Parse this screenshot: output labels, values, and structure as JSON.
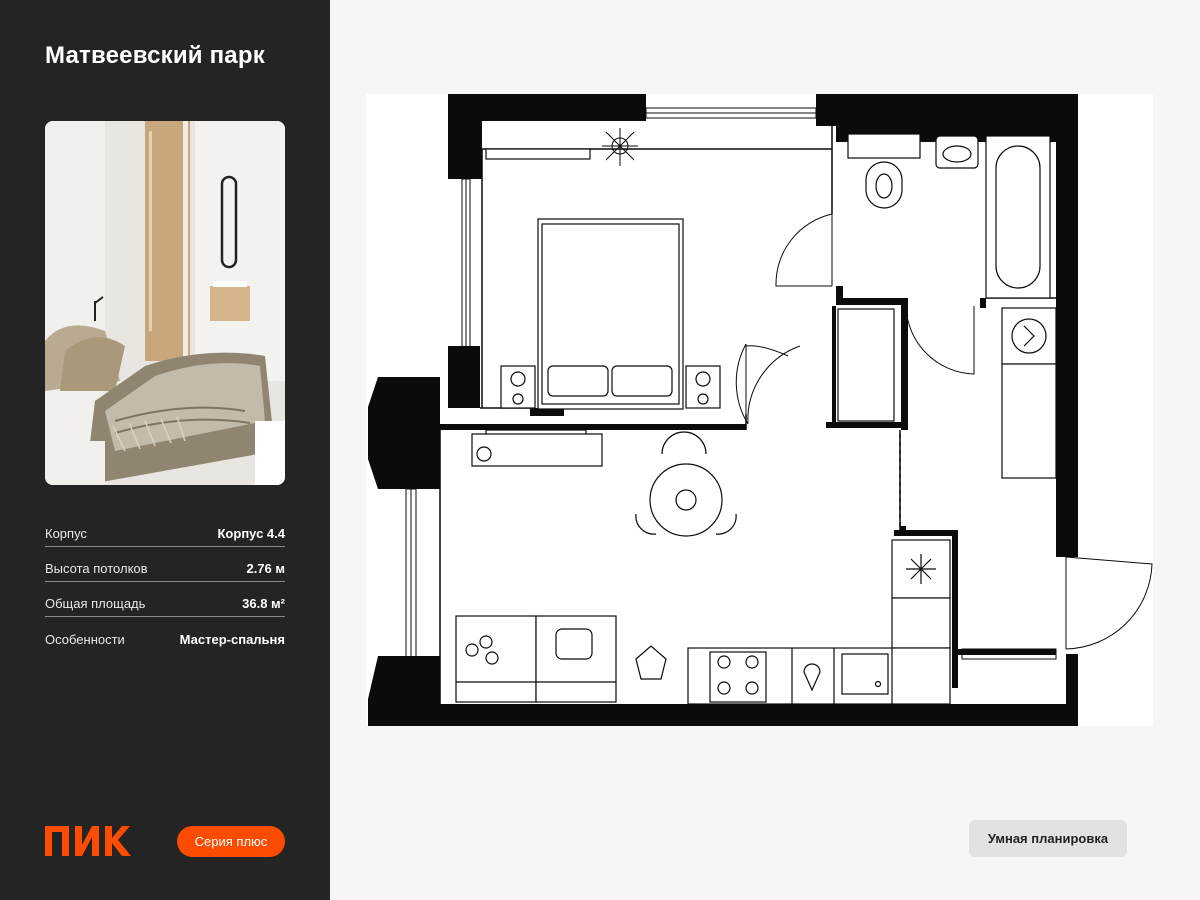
{
  "project": {
    "title": "Матвеевский парк"
  },
  "photo": {
    "icon": "bedroom-interior-photo"
  },
  "specs": [
    {
      "label": "Корпус",
      "value": "Корпус 4.4"
    },
    {
      "label": "Высота потолков",
      "value": "2.76 м"
    },
    {
      "label": "Общая площадь",
      "value": "36.8 м²"
    },
    {
      "label": "Особенности",
      "value": "Мастер-спальня"
    }
  ],
  "brand": {
    "logo_text": "ПИК",
    "series_label": "Серия плюс",
    "accent": "#fc4c02"
  },
  "plan": {
    "icon": "floor-plan-drawing"
  },
  "smart_layout": {
    "label": "Умная планировка"
  }
}
